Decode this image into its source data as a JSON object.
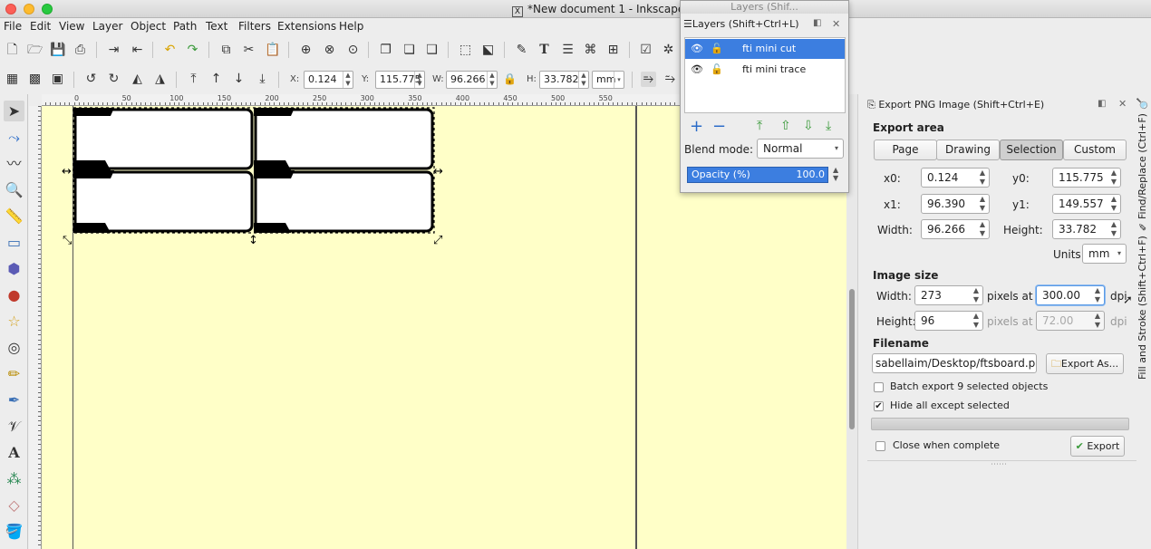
{
  "window": {
    "title": "*New document 1 - Inkscape",
    "x11": "X"
  },
  "menu": [
    "File",
    "Edit",
    "View",
    "Layer",
    "Object",
    "Path",
    "Text",
    "Filters",
    "Extensions",
    "Help"
  ],
  "controls": {
    "x_label": "X:",
    "x_value": "0.124",
    "y_label": "Y:",
    "y_value": "115.775",
    "w_label": "W:",
    "w_value": "96.266",
    "h_label": "H:",
    "h_value": "33.782",
    "unit": "mm"
  },
  "ruler_labels": [
    "0",
    "50",
    "100",
    "150",
    "200",
    "250",
    "300",
    "350",
    "400",
    "450",
    "500",
    "550"
  ],
  "layers_window": {
    "title": "Layers (Shif...",
    "header": "Layers (Shift+Ctrl+L)",
    "layers": [
      {
        "name": "fti mini cut",
        "selected": true
      },
      {
        "name": "fti mini trace",
        "selected": false
      }
    ],
    "blend_label": "Blend mode:",
    "blend_value": "Normal",
    "opacity_label": "Opacity (%)",
    "opacity_value": "100.0"
  },
  "export": {
    "header": "Export PNG Image (Shift+Ctrl+E)",
    "area_title": "Export area",
    "area_buttons": [
      "Page",
      "Drawing",
      "Selection",
      "Custom"
    ],
    "active_area": "Selection",
    "x0_label": "x0:",
    "x0": "0.124",
    "y0_label": "y0:",
    "y0": "115.775",
    "x1_label": "x1:",
    "x1": "96.390",
    "y1_label": "y1:",
    "y1": "149.557",
    "width_label": "Width:",
    "width": "96.266",
    "height_label": "Height:",
    "height": "33.782",
    "units_label": "Units:",
    "units": "mm",
    "image_size_title": "Image size",
    "img_width_label": "Width:",
    "img_width": "273",
    "img_height_label": "Height:",
    "img_height": "96",
    "pixels_at": "pixels at",
    "dpi_value": "300.00",
    "dpi_value2": "72.00",
    "dpi": "dpi",
    "filename_title": "Filename",
    "filename": "sabellaim/Desktop/ftsboard.png",
    "export_as": "Export As...",
    "batch": "Batch export 9 selected objects",
    "hide": "Hide all except selected",
    "close_when_complete": "Close when complete",
    "export_button": "Export"
  },
  "side_tabs": [
    "Find/Replace (Ctrl+F)",
    "Fill and Stroke (Shift+Ctrl+F)"
  ],
  "colors": {
    "canvas": "#ffffc8",
    "selection": "#3c7ee0"
  }
}
